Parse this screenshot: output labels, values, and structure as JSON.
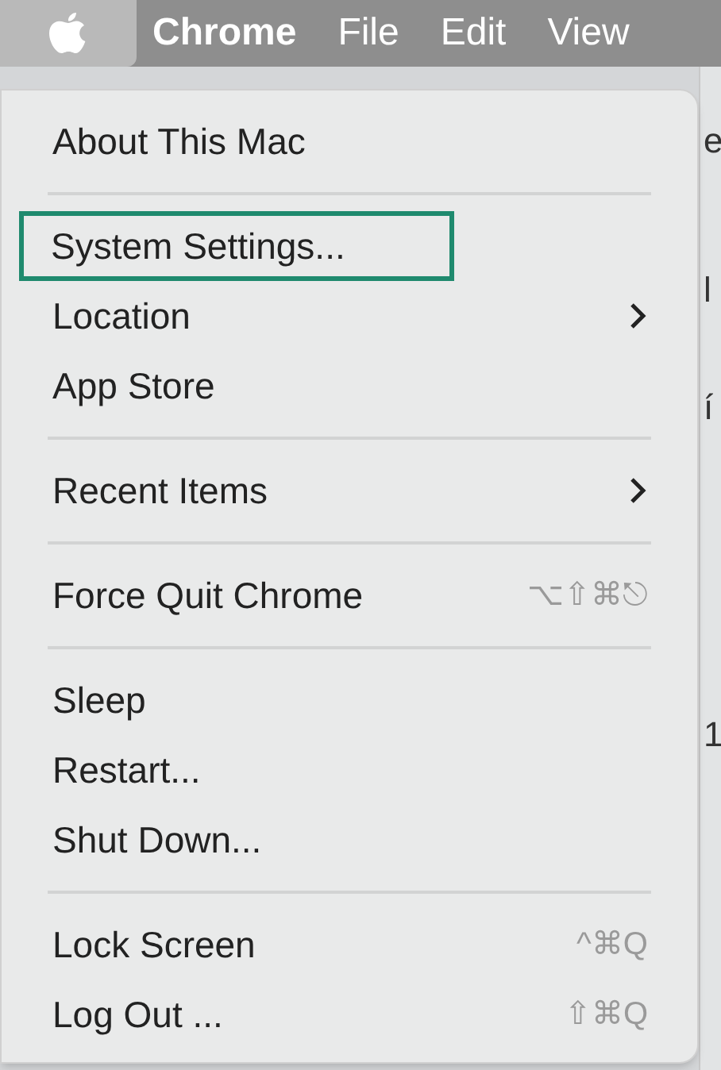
{
  "menu_bar": {
    "apple_selected": true,
    "items": [
      {
        "label": "Chrome",
        "bold": true
      },
      {
        "label": "File",
        "bold": false
      },
      {
        "label": "Edit",
        "bold": false
      },
      {
        "label": "View",
        "bold": false
      }
    ]
  },
  "background_fragments": [
    "e",
    "l",
    "í",
    "1"
  ],
  "menu": {
    "sections": [
      [
        {
          "label": "About This Mac",
          "focused": false
        }
      ],
      [
        {
          "label": "System Settings...",
          "focused": true
        },
        {
          "label": "Location",
          "submenu": true,
          "focused": false
        },
        {
          "label": "App Store",
          "focused": false
        }
      ],
      [
        {
          "label": "Recent Items",
          "submenu": true,
          "focused": false
        }
      ],
      [
        {
          "label": "Force Quit Chrome",
          "shortcut": "⌥⇧⌘⎋",
          "focused": false
        }
      ],
      [
        {
          "label": "Sleep",
          "focused": false
        },
        {
          "label": "Restart...",
          "focused": false
        },
        {
          "label": "Shut Down...",
          "focused": false
        }
      ],
      [
        {
          "label": "Lock Screen",
          "shortcut": "^⌘Q",
          "focused": false
        },
        {
          "label": "Log Out ...",
          "shortcut": "⇧⌘Q",
          "focused": false
        }
      ]
    ]
  }
}
